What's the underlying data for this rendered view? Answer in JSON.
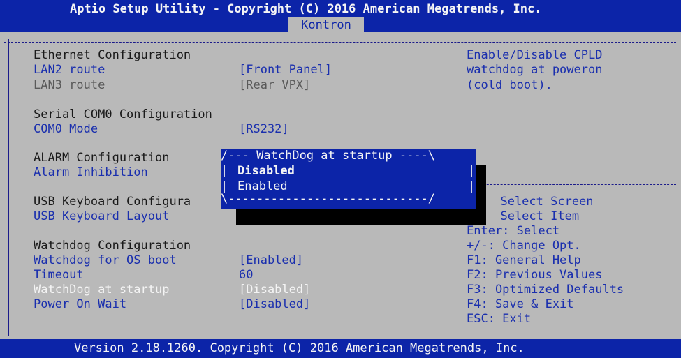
{
  "header": {
    "title": "Aptio Setup Utility - Copyright (C) 2016 American Megatrends, Inc.",
    "tab": "Kontron"
  },
  "left_panel": {
    "ethernet_header": "Ethernet Configuration",
    "lan2_label": "LAN2 route",
    "lan2_value": "[Front Panel]",
    "lan3_label": "LAN3 route",
    "lan3_value": "[Rear VPX]",
    "serial_header": "Serial COM0 Configuration",
    "com0_label": "COM0 Mode",
    "com0_value": "[RS232]",
    "alarm_header": "ALARM Configuration",
    "alarm_label": "Alarm Inhibition",
    "usb_header": "USB Keyboard Configura",
    "usb_layout_label": "USB Keyboard Layout",
    "watchdog_header": "Watchdog Configuration",
    "wd_os_label": "Watchdog for OS boot",
    "wd_os_value": "[Enabled]",
    "timeout_label": "Timeout",
    "timeout_value": "60",
    "wd_startup_label": "WatchDog at startup",
    "wd_startup_value": "[Disabled]",
    "power_label": "Power On Wait",
    "power_value": "[Disabled]"
  },
  "popup": {
    "title": "/--- WatchDog at startup ----\\",
    "bottom": "\\----------------------------/",
    "options": [
      "Disabled",
      "Enabled"
    ],
    "selected": "Disabled"
  },
  "help": {
    "line1": "Enable/Disable CPLD",
    "line2": "watchdog at poweron",
    "line3": "(cold boot).",
    "keys": [
      "  Select Screen",
      "  Select Item",
      "Enter: Select",
      "+/-: Change Opt.",
      "F1: General Help",
      "F2: Previous Values",
      "F3: Optimized Defaults",
      "F4: Save & Exit",
      "ESC: Exit"
    ]
  },
  "footer": {
    "text": "Version 2.18.1260. Copyright (C) 2016 American Megatrends, Inc."
  },
  "colors": {
    "bar_blue": "#0c24a8",
    "background_grey": "#b9b9b9",
    "item_blue": "#1a2fae"
  }
}
